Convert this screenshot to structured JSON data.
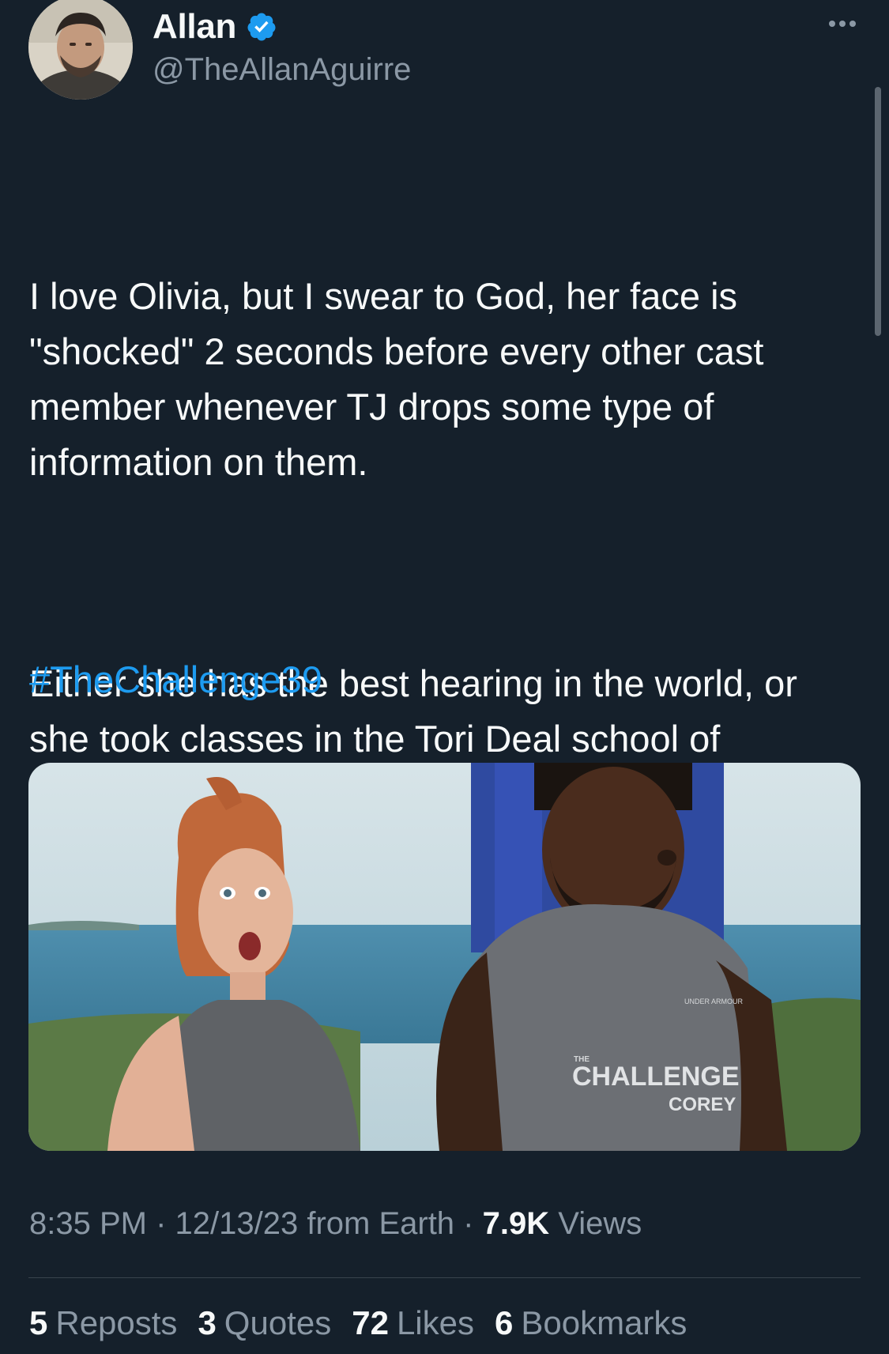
{
  "author": {
    "display_name": "Allan",
    "handle": "@TheAllanAguirre",
    "verified": true,
    "avatar_icon": "avatar-photo"
  },
  "tweet": {
    "paragraphs": [
      "I love Olivia, but I swear to God, her face is \"shocked\" 2 seconds before every other cast member whenever TJ drops some type of information on them.",
      "Either she has the best hearing in the world, or she took classes in the Tori Deal school of reacting."
    ],
    "hashtag": "#TheChallenge39",
    "media": {
      "shirt_brand": "UNDER ARMOUR",
      "shirt_logo_prefix": "THE",
      "shirt_title": "CHALLENGE",
      "shirt_name": "COREY"
    }
  },
  "meta": {
    "time": "8:35 PM",
    "separator": " · ",
    "date_location": "12/13/23 from Earth",
    "views_count": "7.9K",
    "views_label": "Views"
  },
  "stats": [
    {
      "count": "5",
      "label": "Reposts"
    },
    {
      "count": "3",
      "label": "Quotes"
    },
    {
      "count": "72",
      "label": "Likes"
    },
    {
      "count": "6",
      "label": "Bookmarks"
    }
  ],
  "colors": {
    "background": "#15202b",
    "text": "#f7f9f9",
    "secondary": "#8b98a5",
    "accent": "#1d9bf0",
    "divider": "#38444d"
  }
}
